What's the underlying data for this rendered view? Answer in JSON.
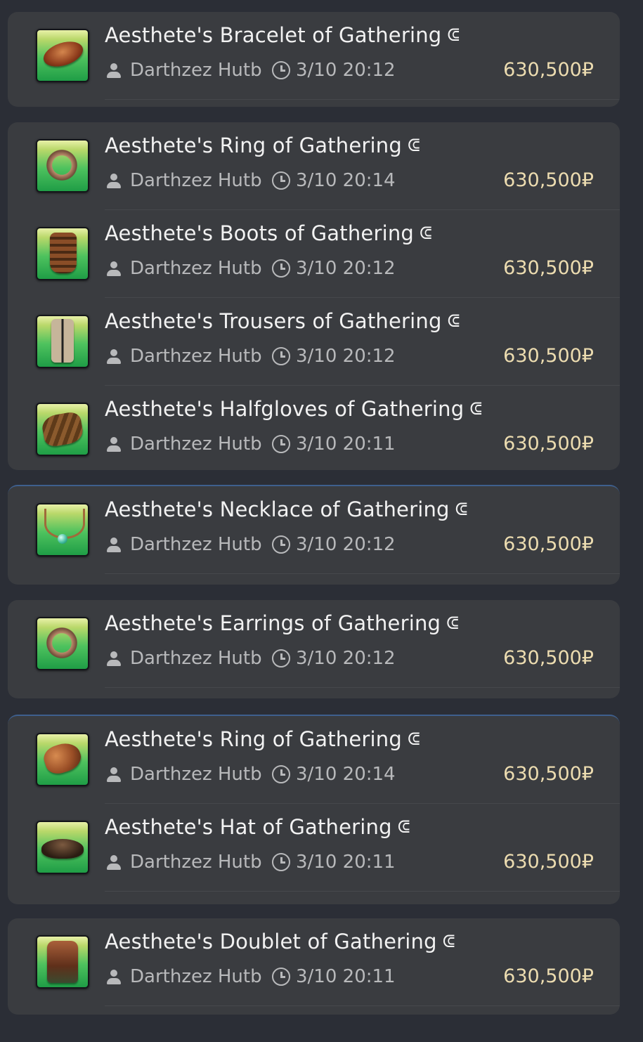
{
  "currency_symbol": "₽",
  "hq_icon": "high-quality-icon",
  "groups": [
    {
      "items": [
        {
          "name": "Aesthete's Bracelet of Gathering",
          "seller": "Darthzez Hutb...",
          "time": "3/10 20:12",
          "price": "630,500₽",
          "icon": "bracelet-icon"
        }
      ]
    },
    {
      "items": [
        {
          "name": "Aesthete's Ring of Gathering",
          "seller": "Darthzez Hutb...",
          "time": "3/10 20:14",
          "price": "630,500₽",
          "icon": "ring-icon"
        },
        {
          "name": "Aesthete's Boots of Gathering",
          "seller": "Darthzez Hutb...",
          "time": "3/10 20:12",
          "price": "630,500₽",
          "icon": "boots-icon"
        },
        {
          "name": "Aesthete's Trousers of Gathering",
          "seller": "Darthzez Hutb...",
          "time": "3/10 20:12",
          "price": "630,500₽",
          "icon": "trousers-icon"
        },
        {
          "name": "Aesthete's Halfgloves of Gathering",
          "seller": "Darthzez Hutb...",
          "time": "3/10 20:11",
          "price": "630,500₽",
          "icon": "halfgloves-icon"
        }
      ]
    },
    {
      "items": [
        {
          "name": "Aesthete's Necklace of Gathering",
          "seller": "Darthzez Hutb...",
          "time": "3/10 20:12",
          "price": "630,500₽",
          "icon": "necklace-icon"
        }
      ]
    },
    {
      "items": [
        {
          "name": "Aesthete's Earrings of Gathering",
          "seller": "Darthzez Hutb...",
          "time": "3/10 20:12",
          "price": "630,500₽",
          "icon": "earrings-icon"
        }
      ]
    },
    {
      "items": [
        {
          "name": "Aesthete's Ring of Gathering",
          "seller": "Darthzez Hutb...",
          "time": "3/10 20:14",
          "price": "630,500₽",
          "icon": "ring-icon"
        },
        {
          "name": "Aesthete's Hat of Gathering",
          "seller": "Darthzez Hutb...",
          "time": "3/10 20:11",
          "price": "630,500₽",
          "icon": "hat-icon"
        }
      ]
    },
    {
      "items": [
        {
          "name": "Aesthete's Doublet of Gathering",
          "seller": "Darthzez Hutb...",
          "time": "3/10 20:11",
          "price": "630,500₽",
          "icon": "doublet-icon"
        }
      ]
    }
  ]
}
